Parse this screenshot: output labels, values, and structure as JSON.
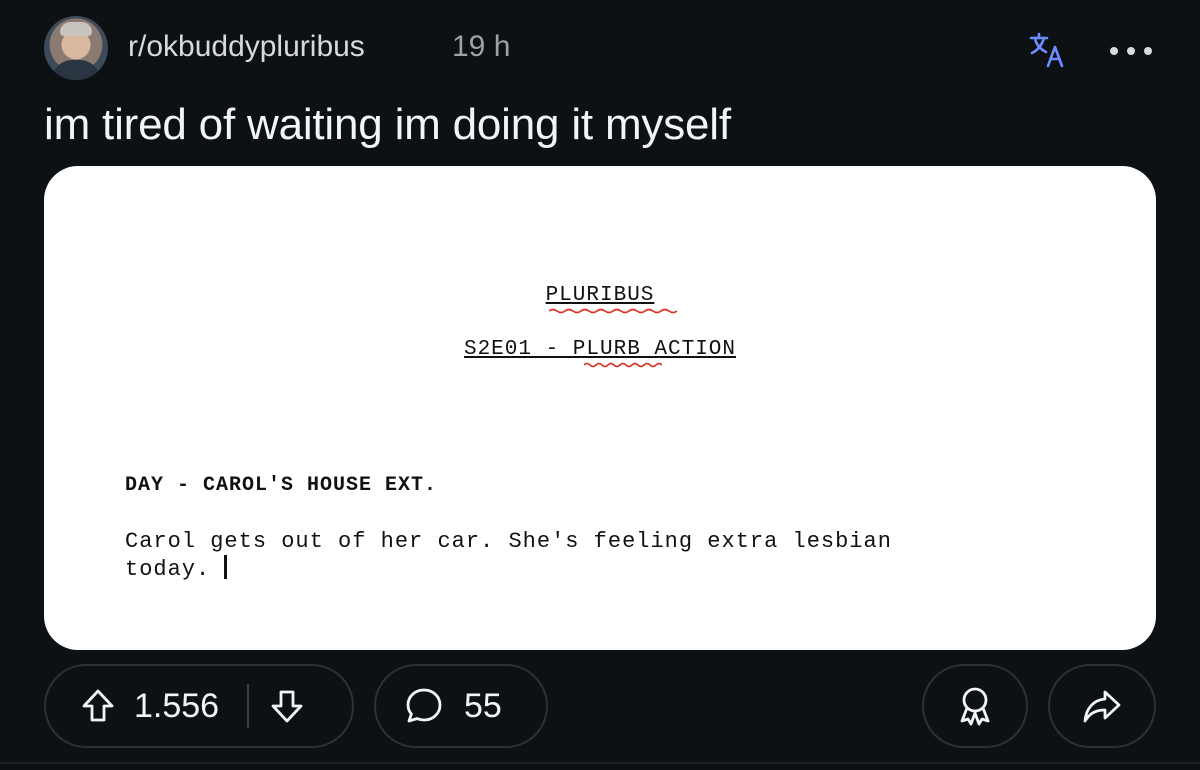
{
  "post": {
    "subreddit": "r/okbuddypluribus",
    "time_ago": "19 h",
    "title": "im tired of waiting im doing it myself"
  },
  "media": {
    "doc_title": "PLURIBUS",
    "doc_episode": "S2E01 - PLURB ACTION",
    "scene_heading": "DAY - CAROL'S HOUSE EXT.",
    "action_line_1": "Carol gets out of her car. She's feeling extra lesbian",
    "action_line_2": "today."
  },
  "actions": {
    "vote_count": "1.556",
    "comment_count": "55"
  },
  "icons": {
    "translate": "translate-icon",
    "more": "more-options-icon",
    "upvote": "upvote-arrow-icon",
    "downvote": "downvote-arrow-icon",
    "comment": "comment-bubble-icon",
    "award": "award-icon",
    "share": "share-arrow-icon"
  },
  "colors": {
    "background": "#0e1113",
    "accent_translate": "#6d8cff",
    "spellcheck": "#d93025"
  }
}
